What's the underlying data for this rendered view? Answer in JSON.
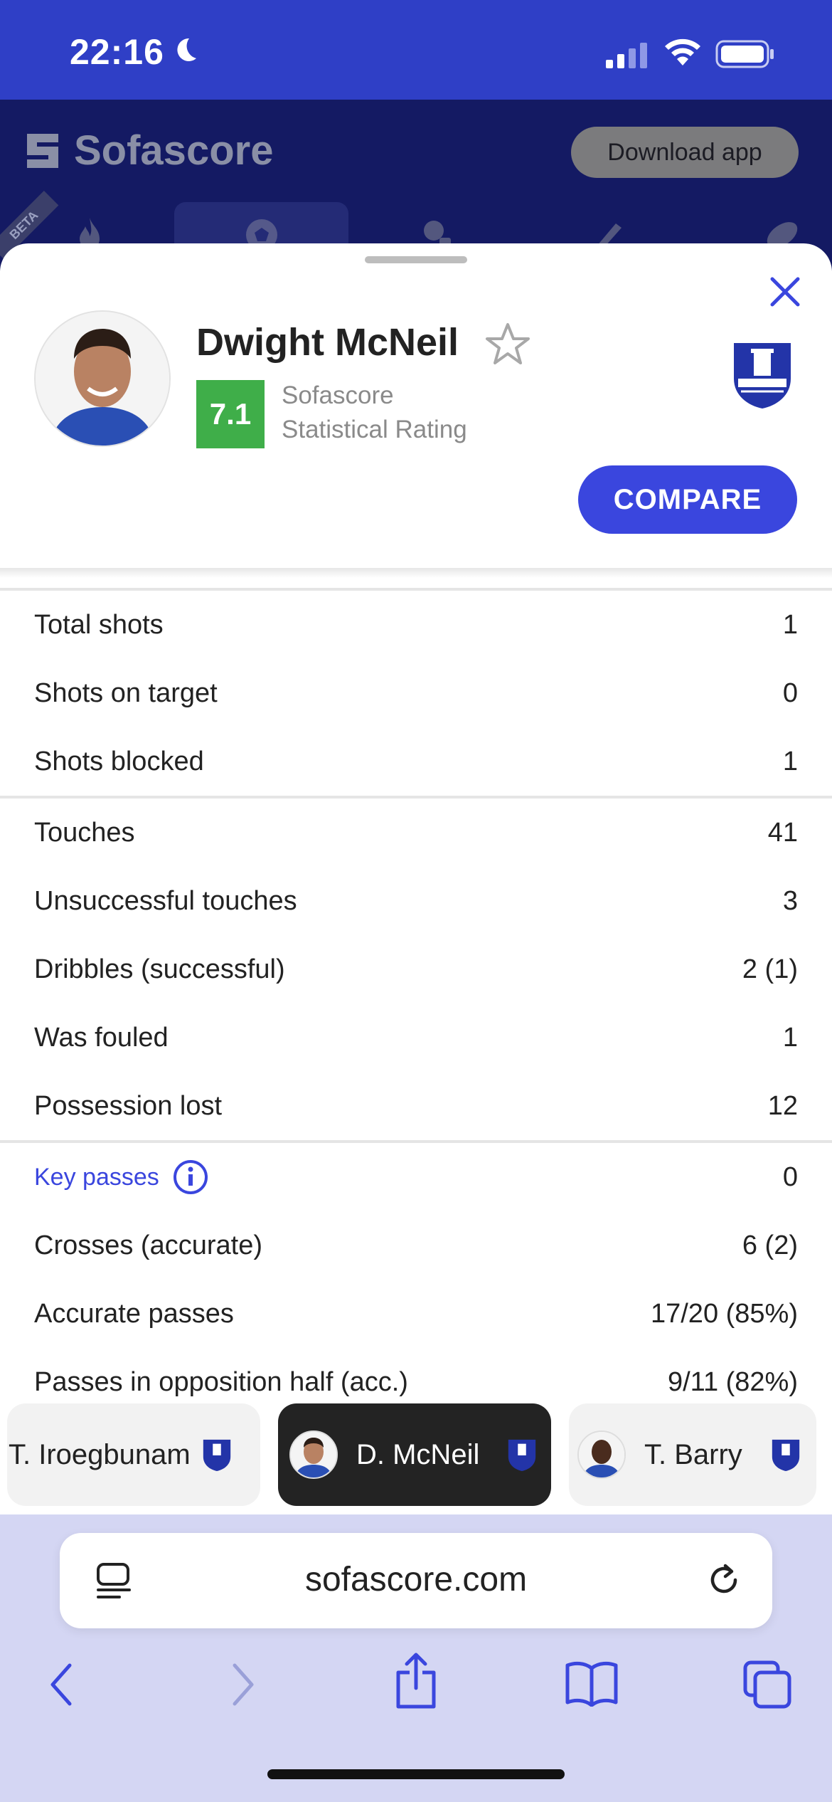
{
  "status_bar": {
    "time": "22:16"
  },
  "app_bar": {
    "logo_text": "Sofascore",
    "download_label": "Download app",
    "beta_label": "BETA"
  },
  "player": {
    "name": "Dwight McNeil",
    "rating": "7.1",
    "rating_label_1": "Sofascore",
    "rating_label_2": "Statistical Rating",
    "compare_label": "COMPARE"
  },
  "stats": {
    "group1": [
      {
        "label": "Total shots",
        "value": "1"
      },
      {
        "label": "Shots on target",
        "value": "0"
      },
      {
        "label": "Shots blocked",
        "value": "1"
      }
    ],
    "group2": [
      {
        "label": "Touches",
        "value": "41"
      },
      {
        "label": "Unsuccessful touches",
        "value": "3"
      },
      {
        "label": "Dribbles (successful)",
        "value": "2 (1)"
      },
      {
        "label": "Was fouled",
        "value": "1"
      },
      {
        "label": "Possession lost",
        "value": "12"
      }
    ],
    "group3": [
      {
        "label": "Key passes",
        "value": "0"
      },
      {
        "label": "Crosses (accurate)",
        "value": "6 (2)"
      },
      {
        "label": "Accurate passes",
        "value": "17/20 (85%)"
      },
      {
        "label": "Passes in opposition half (acc.)",
        "value": "9/11 (82%)"
      }
    ]
  },
  "player_switcher": [
    {
      "name": "T. Iroegbunam"
    },
    {
      "name": "D. McNeil"
    },
    {
      "name": "T. Barry"
    }
  ],
  "browser": {
    "url": "sofascore.com"
  },
  "colors": {
    "brand_blue": "#2f3fc6",
    "accent": "#3a46de",
    "rating_green": "#3fae49"
  }
}
